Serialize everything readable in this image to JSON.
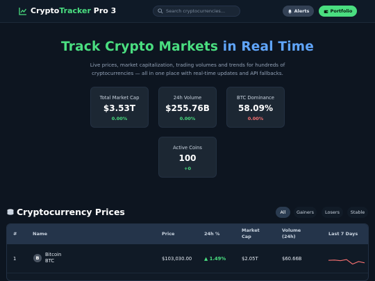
{
  "header": {
    "brand_main": "Crypto",
    "brand_accent": "Tracker",
    "brand_suffix": " Pro 3",
    "search_placeholder": "Search cryptocurrencies...",
    "alerts_label": "Alerts",
    "portfolio_label": "Portfolio"
  },
  "hero": {
    "title_part1": "Track Crypto Markets",
    "title_part2": "in Real Time",
    "description": "Live prices, market capitalization, trading volumes and trends for hundreds of cryptocurrencies — all in one place with real-time updates and API fallbacks."
  },
  "stats": [
    {
      "label": "Total Market Cap",
      "value": "$3.53T",
      "change": "0.00%"
    },
    {
      "label": "24h Volume",
      "value": "$255.76B",
      "change": "0.00%"
    },
    {
      "label": "BTC Dominance",
      "value": "58.09%",
      "change": "0.00%"
    },
    {
      "label": "Active Coins",
      "value": "100",
      "change": "+0"
    }
  ],
  "prices": {
    "title": "Cryptocurrency Prices",
    "filters": [
      "All",
      "Gainers",
      "Losers",
      "Stable"
    ],
    "columns": {
      "rank": "#",
      "name": "Name",
      "price": "Price",
      "change": "24h %",
      "mcap_1": "Market",
      "mcap_2": "Cap",
      "volume_1": "Volume",
      "volume_2": "(24h)",
      "spark": "Last 7 Days"
    },
    "rows": [
      {
        "rank": "1",
        "icon_letter": "B",
        "name": "Bitcoin",
        "symbol": "BTC",
        "price": "$103,030.00",
        "change": "▲ 1.49%",
        "market_cap": "$2.05T",
        "volume": "$60.66B",
        "sparkline": [
          0.62,
          0.6,
          0.65,
          0.56,
          0.92,
          0.72,
          0.82
        ]
      }
    ]
  },
  "colors": {
    "accent_green": "#4ade80",
    "accent_blue": "#60a5fa",
    "negative_red": "#f87171",
    "sparkline": "#f87171"
  }
}
